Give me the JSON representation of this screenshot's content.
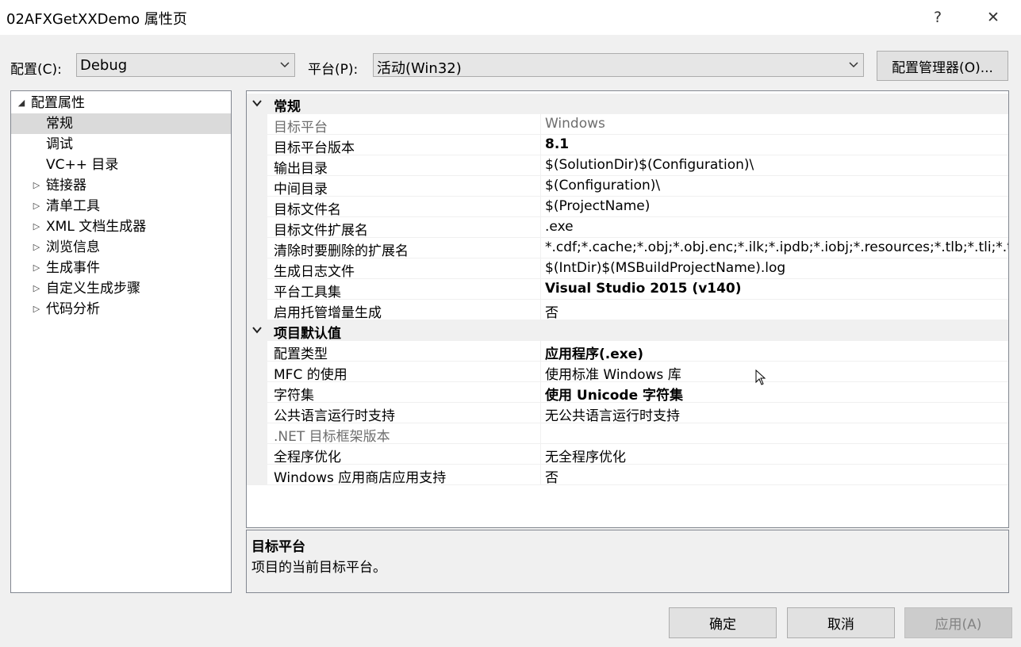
{
  "window": {
    "title": "02AFXGetXXDemo 属性页",
    "help_glyph": "?",
    "close_glyph": "✕"
  },
  "toolbar": {
    "config_label": "配置(C):",
    "config_value": "Debug",
    "platform_label": "平台(P):",
    "platform_value": "活动(Win32)",
    "config_manager_label": "配置管理器(O)..."
  },
  "tree": {
    "items": [
      {
        "label": "配置属性",
        "expander": "◢",
        "level": 0
      },
      {
        "label": "常规",
        "expander": "",
        "level": 1,
        "selected": true
      },
      {
        "label": "调试",
        "expander": "",
        "level": 1
      },
      {
        "label": "VC++ 目录",
        "expander": "",
        "level": 1
      },
      {
        "label": "链接器",
        "expander": "▷",
        "level": 1
      },
      {
        "label": "清单工具",
        "expander": "▷",
        "level": 1
      },
      {
        "label": "XML 文档生成器",
        "expander": "▷",
        "level": 1
      },
      {
        "label": "浏览信息",
        "expander": "▷",
        "level": 1
      },
      {
        "label": "生成事件",
        "expander": "▷",
        "level": 1
      },
      {
        "label": "自定义生成步骤",
        "expander": "▷",
        "level": 1
      },
      {
        "label": "代码分析",
        "expander": "▷",
        "level": 1
      }
    ]
  },
  "grid": {
    "categories": [
      {
        "label": "常规",
        "props": [
          {
            "name": "目标平台",
            "value": "Windows",
            "bold": false,
            "disabled": true
          },
          {
            "name": "目标平台版本",
            "value": "8.1",
            "bold": true,
            "disabled": false
          },
          {
            "name": "输出目录",
            "value": "$(SolutionDir)$(Configuration)\\",
            "bold": false,
            "disabled": false
          },
          {
            "name": "中间目录",
            "value": "$(Configuration)\\",
            "bold": false,
            "disabled": false
          },
          {
            "name": "目标文件名",
            "value": "$(ProjectName)",
            "bold": false,
            "disabled": false
          },
          {
            "name": "目标文件扩展名",
            "value": ".exe",
            "bold": false,
            "disabled": false
          },
          {
            "name": "清除时要删除的扩展名",
            "value": "*.cdf;*.cache;*.obj;*.obj.enc;*.ilk;*.ipdb;*.iobj;*.resources;*.tlb;*.tli;*.tlh;*.tmp",
            "bold": false,
            "disabled": false
          },
          {
            "name": "生成日志文件",
            "value": "$(IntDir)$(MSBuildProjectName).log",
            "bold": false,
            "disabled": false
          },
          {
            "name": "平台工具集",
            "value": "Visual Studio 2015 (v140)",
            "bold": true,
            "disabled": false
          },
          {
            "name": "启用托管增量生成",
            "value": "否",
            "bold": false,
            "disabled": false
          }
        ]
      },
      {
        "label": "项目默认值",
        "props": [
          {
            "name": "配置类型",
            "value": "应用程序(.exe)",
            "bold": true,
            "disabled": false
          },
          {
            "name": "MFC 的使用",
            "value": "使用标准 Windows 库",
            "bold": false,
            "disabled": false
          },
          {
            "name": "字符集",
            "value": "使用 Unicode 字符集",
            "bold": true,
            "disabled": false
          },
          {
            "name": "公共语言运行时支持",
            "value": "无公共语言运行时支持",
            "bold": false,
            "disabled": false
          },
          {
            "name": ".NET 目标框架版本",
            "value": "",
            "bold": false,
            "disabled": true
          },
          {
            "name": "全程序优化",
            "value": "无全程序优化",
            "bold": false,
            "disabled": false
          },
          {
            "name": "Windows 应用商店应用支持",
            "value": "否",
            "bold": false,
            "disabled": false
          }
        ]
      }
    ]
  },
  "description": {
    "title": "目标平台",
    "text": "项目的当前目标平台。"
  },
  "footer": {
    "ok_label": "确定",
    "cancel_label": "取消",
    "apply_label": "应用(A)"
  },
  "colors": {
    "accent_selected": "#dadada",
    "disabled_text": "#6d6d6d"
  }
}
